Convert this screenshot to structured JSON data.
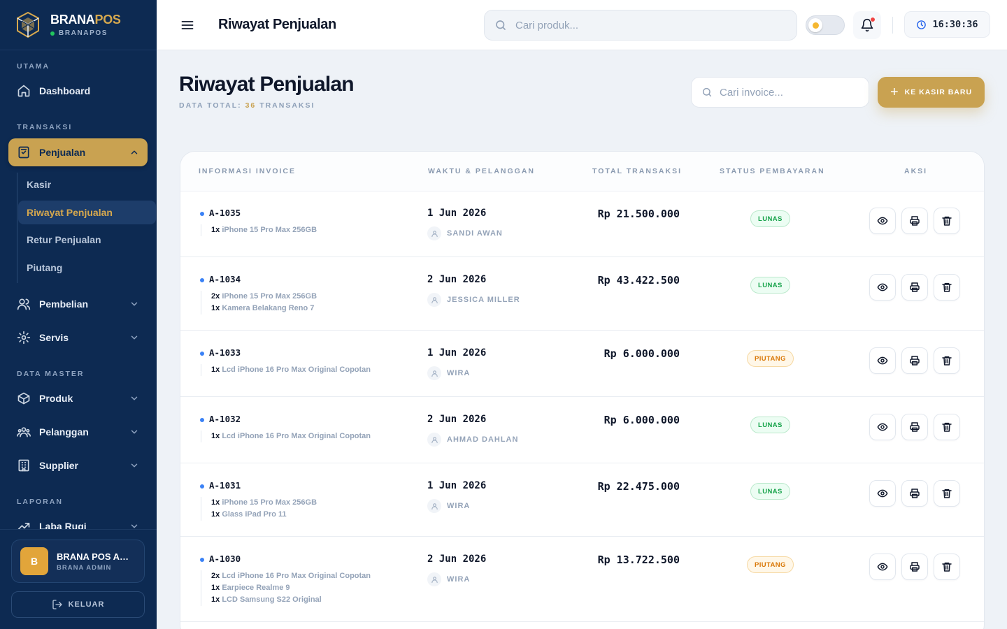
{
  "brand": {
    "name_main": "BRANA",
    "name_accent": "POS",
    "subtitle": "BRANAPOS"
  },
  "sidebar": {
    "sections": {
      "utama": "UTAMA",
      "transaksi": "TRANSAKSI",
      "data_master": "DATA MASTER",
      "laporan": "LAPORAN"
    },
    "dashboard": "Dashboard",
    "penjualan": "Penjualan",
    "sub": [
      "Kasir",
      "Riwayat Penjualan",
      "Retur Penjualan",
      "Piutang"
    ],
    "pembelian": "Pembelian",
    "servis": "Servis",
    "produk": "Produk",
    "pelanggan": "Pelanggan",
    "supplier": "Supplier",
    "laba_rugi": "Laba Rugi"
  },
  "user": {
    "initial": "B",
    "name": "BRANA POS ADMIN",
    "role": "BRANA ADMIN"
  },
  "logout_label": "KELUAR",
  "topbar": {
    "title": "Riwayat Penjualan",
    "search_placeholder": "Cari produk...",
    "time": "16:30:36"
  },
  "page": {
    "title": "Riwayat Penjualan",
    "subtitle_prefix": "DATA TOTAL:",
    "total_count": "36",
    "subtitle_suffix": "TRANSAKSI",
    "invoice_search_placeholder": "Cari invoice...",
    "new_button": "KE KASIR BARU"
  },
  "table": {
    "headers": [
      "INFORMASI INVOICE",
      "WAKTU & PELANGGAN",
      "TOTAL TRANSAKSI",
      "STATUS PEMBAYARAN",
      "AKSI"
    ],
    "rows": [
      {
        "invoice": "A-1035",
        "items": [
          {
            "qty": "1x",
            "name": "iPhone 15 Pro Max 256GB"
          }
        ],
        "date": "1 Jun 2026",
        "customer": "SANDI AWAN",
        "total": "Rp 21.500.000",
        "status": "LUNAS"
      },
      {
        "invoice": "A-1034",
        "items": [
          {
            "qty": "2x",
            "name": "iPhone 15 Pro Max 256GB"
          },
          {
            "qty": "1x",
            "name": "Kamera Belakang Reno 7"
          }
        ],
        "date": "2 Jun 2026",
        "customer": "JESSICA MILLER",
        "total": "Rp 43.422.500",
        "status": "LUNAS"
      },
      {
        "invoice": "A-1033",
        "items": [
          {
            "qty": "1x",
            "name": "Lcd iPhone 16 Pro Max Original Copotan"
          }
        ],
        "date": "1 Jun 2026",
        "customer": "WIRA",
        "total": "Rp 6.000.000",
        "status": "PIUTANG"
      },
      {
        "invoice": "A-1032",
        "items": [
          {
            "qty": "1x",
            "name": "Lcd iPhone 16 Pro Max Original Copotan"
          }
        ],
        "date": "2 Jun 2026",
        "customer": "AHMAD DAHLAN",
        "total": "Rp 6.000.000",
        "status": "LUNAS"
      },
      {
        "invoice": "A-1031",
        "items": [
          {
            "qty": "1x",
            "name": "iPhone 15 Pro Max 256GB"
          },
          {
            "qty": "1x",
            "name": "Glass iPad Pro 11"
          }
        ],
        "date": "1 Jun 2026",
        "customer": "WIRA",
        "total": "Rp 22.475.000",
        "status": "LUNAS"
      },
      {
        "invoice": "A-1030",
        "items": [
          {
            "qty": "2x",
            "name": "Lcd iPhone 16 Pro Max Original Copotan"
          },
          {
            "qty": "1x",
            "name": "Earpiece Realme 9"
          },
          {
            "qty": "1x",
            "name": "LCD Samsung S22 Original"
          }
        ],
        "date": "2 Jun 2026",
        "customer": "WIRA",
        "total": "Rp 13.722.500",
        "status": "PIUTANG"
      }
    ]
  },
  "colors": {
    "sidebar": "#0d2a52",
    "accent": "#c9a251",
    "lunas": "#16a34a",
    "piutang": "#d97706"
  }
}
